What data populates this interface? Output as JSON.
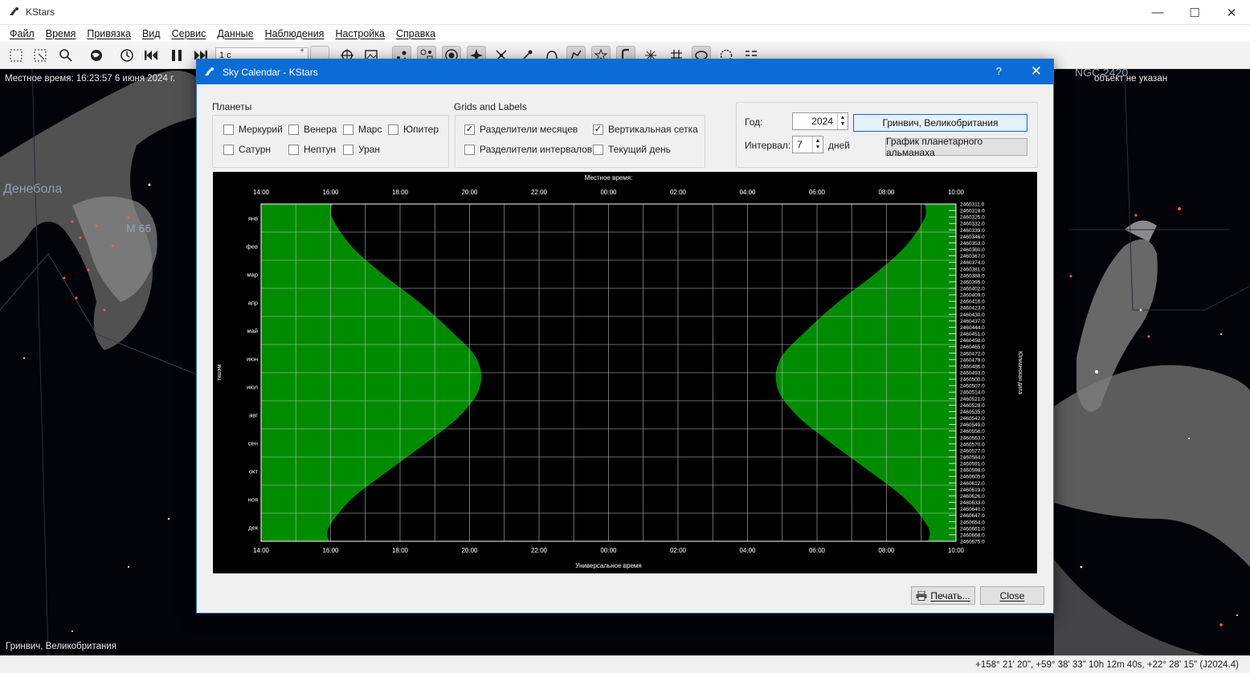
{
  "window": {
    "title": "KStars",
    "minimize": "—",
    "maximize": "☐",
    "close": "✕"
  },
  "menu": [
    "Файл",
    "Время",
    "Привязка",
    "Вид",
    "Сервис",
    "Данные",
    "Наблюдения",
    "Настройка",
    "Справка"
  ],
  "toolbar": {
    "time_step": "1 с",
    "icons": [
      "zoom-fit-icon",
      "zoom-select-icon",
      "find-icon",
      "globe-icon",
      "clock-icon",
      "skip-back-icon",
      "pause-icon",
      "skip-forward-icon",
      "crosshair-icon",
      "image-icon",
      "stars-icon",
      "deep-sky-icon",
      "solar-system-icon",
      "satellite-icon",
      "supernova-icon",
      "comet-icon",
      "asteroid-icon",
      "constellation-lines-icon",
      "constellation-art-icon",
      "constellation-bounds-icon",
      "milky-way-icon",
      "grid-icon",
      "horizon-icon",
      "ground-icon",
      "hips-icon",
      "list-icon"
    ]
  },
  "skymap": {
    "local_time": "Местное время: 16:23:57   6 июня 2024 г.",
    "focus": "объект не указан",
    "location": "Гринвич, Великобритания",
    "labels": {
      "deneb": "Денебола",
      "m66": "М 66",
      "ngc": "NGC 2420"
    }
  },
  "status": {
    "coords": "+158° 21' 20\", +59° 38' 33\"  10h 12m 40s, +22° 28' 15\" (J2024.4)"
  },
  "dialog": {
    "title": "Sky Calendar - KStars",
    "help": "?",
    "close": "✕",
    "planets_group": "Планеты",
    "planets": [
      {
        "label": "Меркурий",
        "checked": false
      },
      {
        "label": "Венера",
        "checked": false
      },
      {
        "label": "Марс",
        "checked": false
      },
      {
        "label": "Юпитер",
        "checked": false
      },
      {
        "label": "Сатурн",
        "checked": false
      },
      {
        "label": "Нептун",
        "checked": false
      },
      {
        "label": "Уран",
        "checked": false
      }
    ],
    "grids_group": "Grids and Labels",
    "grids": [
      {
        "label": "Разделители месяцев",
        "checked": true
      },
      {
        "label": "Вертикальная сетка",
        "checked": true
      },
      {
        "label": "Разделители интервалов",
        "checked": false
      },
      {
        "label": "Текущий день",
        "checked": false
      }
    ],
    "year_label": "Год:",
    "year_value": "2024",
    "location_button": "Гринвич, Великобритания",
    "interval_label": "Интервал:",
    "interval_value": "7",
    "interval_unit": "дней",
    "almanac_button": "График планетарного альманаха",
    "print_button": "Печать...",
    "close_button": "Close"
  },
  "chart_data": {
    "type": "area",
    "top_axis_label": "Местное время:",
    "bottom_axis_label": "Универсальное время",
    "left_axis_label": "ткшэм",
    "right_axis_label": "Юлианская дата",
    "x_ticks": [
      "14:00",
      "16:00",
      "18:00",
      "20:00",
      "22:00",
      "00:00",
      "02:00",
      "04:00",
      "06:00",
      "08:00",
      "10:00"
    ],
    "months": [
      "янв",
      "фев",
      "мар",
      "апр",
      "май",
      "июн",
      "июл",
      "авг",
      "сен",
      "окт",
      "ноя",
      "дек"
    ],
    "julian_dates": [
      "2460311.0",
      "2460318.0",
      "2460325.0",
      "2460332.0",
      "2460339.0",
      "2460346.0",
      "2460353.0",
      "2460360.0",
      "2460367.0",
      "2460374.0",
      "2460381.0",
      "2460388.0",
      "2460395.0",
      "2460402.0",
      "2460409.0",
      "2460416.0",
      "2460423.0",
      "2460430.0",
      "2460437.0",
      "2460444.0",
      "2460451.0",
      "2460458.0",
      "2460465.0",
      "2460472.0",
      "2460479.0",
      "2460486.0",
      "2460493.0",
      "2460500.0",
      "2460507.0",
      "2460514.0",
      "2460521.0",
      "2460528.0",
      "2460535.0",
      "2460542.0",
      "2460549.0",
      "2460556.0",
      "2460563.0",
      "2460570.0",
      "2460577.0",
      "2460584.0",
      "2460591.0",
      "2460598.0",
      "2460605.0",
      "2460612.0",
      "2460619.0",
      "2460626.0",
      "2460633.0",
      "2460640.0",
      "2460647.0",
      "2460654.0",
      "2460661.0",
      "2460668.0",
      "2460675.0"
    ],
    "series": [
      {
        "name": "",
        "x_unit": "hours after 14:00",
        "sunset": [
          2.05,
          2.6,
          3.5,
          4.55,
          5.45,
          6.2,
          6.3,
          5.75,
          4.75,
          3.65,
          2.6,
          1.95
        ],
        "sunrise": [
          19.1,
          18.55,
          17.65,
          16.6,
          15.7,
          14.95,
          14.85,
          15.4,
          16.4,
          17.5,
          18.55,
          19.2
        ]
      }
    ],
    "colors": {
      "fill": "#008c00",
      "background": "#000000",
      "grid": "#bdbdbd"
    }
  }
}
